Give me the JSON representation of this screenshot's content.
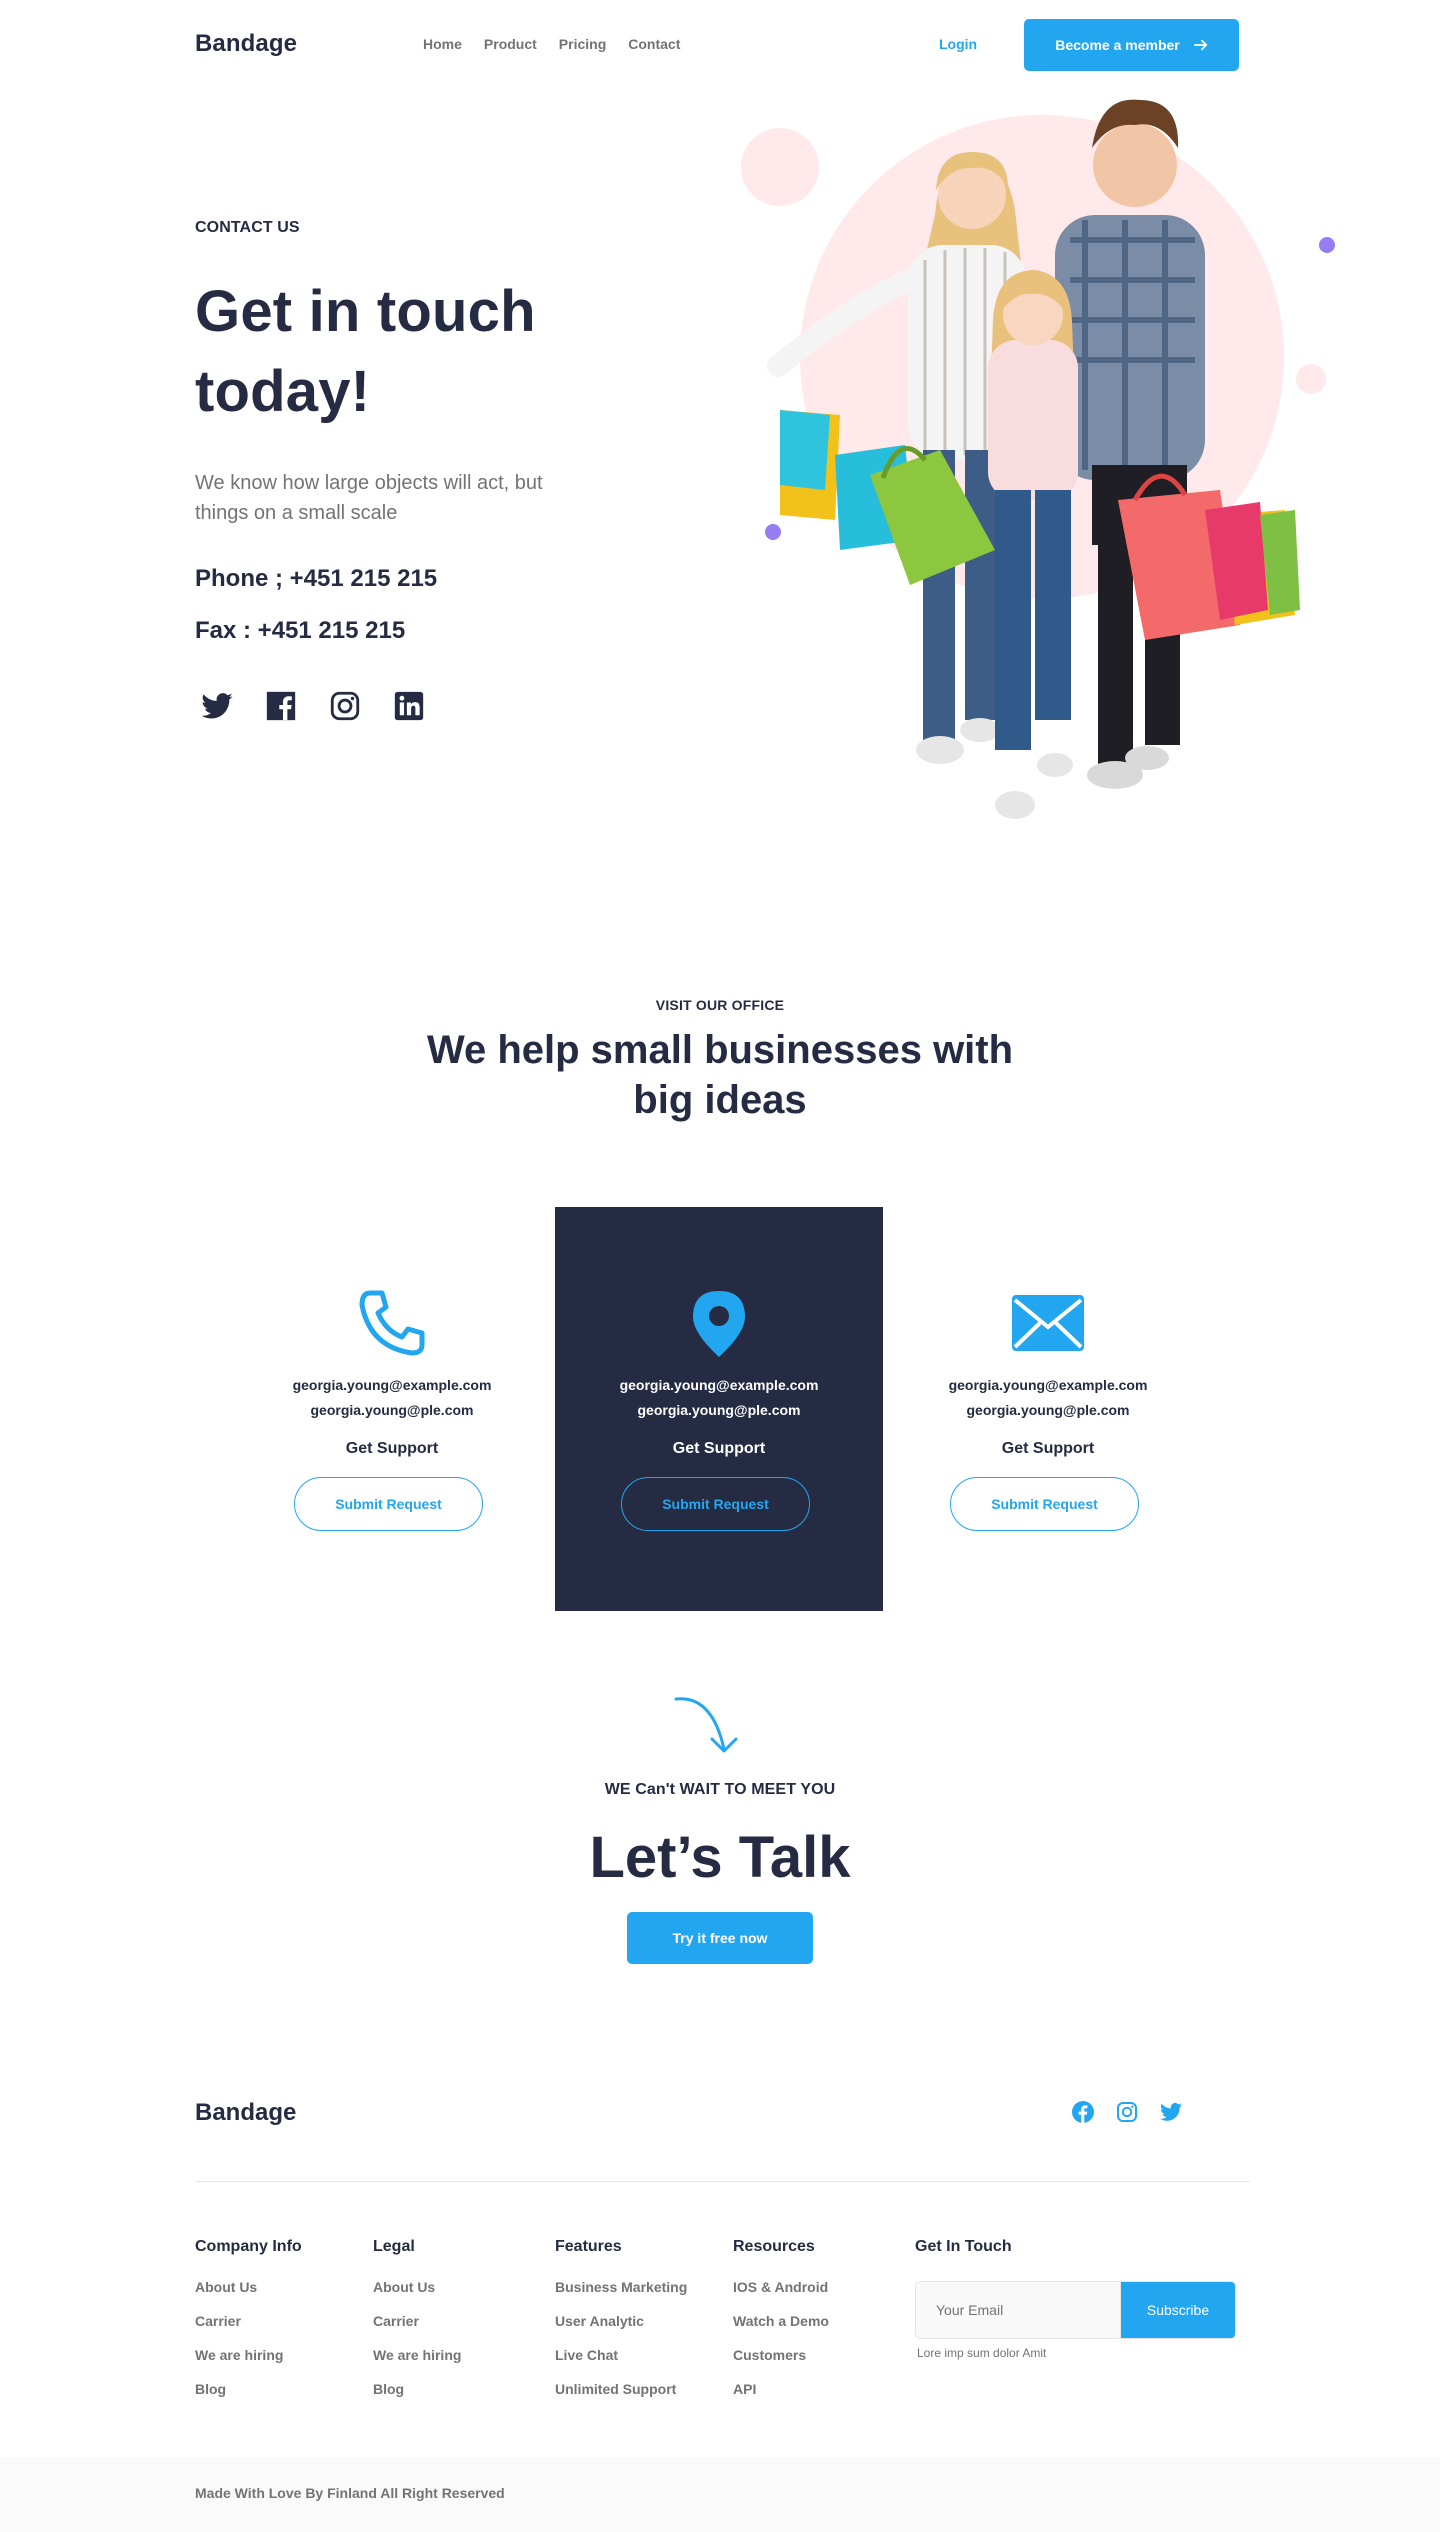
{
  "nav": {
    "brand": "Bandage",
    "links": [
      "Home",
      "Product",
      "Pricing",
      "Contact"
    ],
    "login": "Login",
    "cta": "Become a member"
  },
  "hero": {
    "eyebrow": "CONTACT US",
    "title": "Get in touch today!",
    "description": "We know how large objects will act, but things on a small scale",
    "phone": "Phone ; +451 215 215",
    "fax": "Fax : +451 215 215",
    "socials": [
      "twitter-icon",
      "facebook-icon",
      "instagram-icon",
      "linkedin-icon"
    ]
  },
  "office": {
    "eyebrow": "VISIT OUR OFFICE",
    "title": "We help small businesses with big ideas",
    "cards": [
      {
        "icon": "phone-icon",
        "email1": "georgia.young@example.com",
        "email2": "georgia.young@ple.com",
        "heading": "Get Support",
        "button": "Submit Request"
      },
      {
        "icon": "location-pin-icon",
        "email1": "georgia.young@example.com",
        "email2": "georgia.young@ple.com",
        "heading": "Get Support",
        "button": "Submit Request"
      },
      {
        "icon": "envelope-icon",
        "email1": "georgia.young@example.com",
        "email2": "georgia.young@ple.com",
        "heading": "Get Support",
        "button": "Submit Request"
      }
    ]
  },
  "talk": {
    "eyebrow": "WE Can't WAIT TO MEET YOU",
    "title": "Let’s Talk",
    "button": "Try it free now"
  },
  "footer": {
    "brand": "Bandage",
    "socials": [
      "facebook-icon",
      "instagram-icon",
      "twitter-icon"
    ],
    "columns": [
      {
        "heading": "Company Info",
        "links": [
          "About Us",
          "Carrier",
          "We are hiring",
          "Blog"
        ]
      },
      {
        "heading": "Legal",
        "links": [
          "About Us",
          "Carrier",
          "We are hiring",
          "Blog"
        ]
      },
      {
        "heading": "Features",
        "links": [
          "Business Marketing",
          "User Analytic",
          "Live Chat",
          "Unlimited Support"
        ]
      },
      {
        "heading": "Resources",
        "links": [
          "IOS & Android",
          "Watch a Demo",
          "Customers",
          "API"
        ]
      }
    ],
    "newsletter": {
      "heading": "Get In Touch",
      "placeholder": "Your Email",
      "button": "Subscribe",
      "note": "Lore imp sum dolor Amit"
    },
    "copyright": "Made With Love By Finland All Right Reserved"
  },
  "colors": {
    "primary": "#23A6F0",
    "dark": "#252B42",
    "muted": "#737373",
    "pink": "#FFE9EA",
    "purple": "#977DF4"
  }
}
